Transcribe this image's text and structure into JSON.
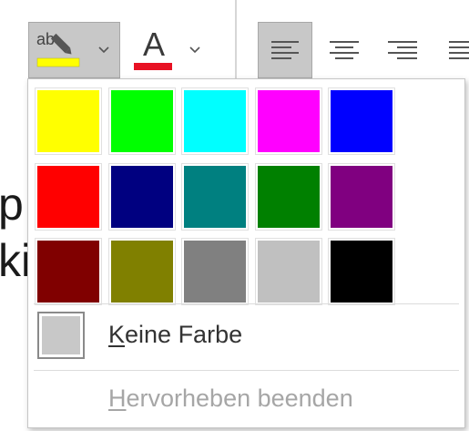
{
  "ribbon": {
    "highlight_button": {
      "icon": "text-highlight-icon",
      "current_color": "#ffff00"
    },
    "font_color_button": {
      "letter": "A",
      "current_color": "#e81123"
    },
    "align_buttons": [
      {
        "name": "align-left",
        "active": true
      },
      {
        "name": "align-center",
        "active": false
      },
      {
        "name": "align-right",
        "active": false
      },
      {
        "name": "justify",
        "active": false
      }
    ]
  },
  "document": {
    "line1": "p",
    "line2": "ki"
  },
  "palette": {
    "colors": [
      [
        "#ffff00",
        "#00ff00",
        "#00ffff",
        "#ff00ff",
        "#0000ff"
      ],
      [
        "#ff0000",
        "#000080",
        "#008080",
        "#008000",
        "#800080"
      ],
      [
        "#800000",
        "#808000",
        "#808080",
        "#c0c0c0",
        "#000000"
      ]
    ],
    "no_color": {
      "accel": "K",
      "rest": "eine Farbe"
    },
    "stop_highlight": {
      "accel": "H",
      "rest": "ervorheben beenden"
    }
  }
}
